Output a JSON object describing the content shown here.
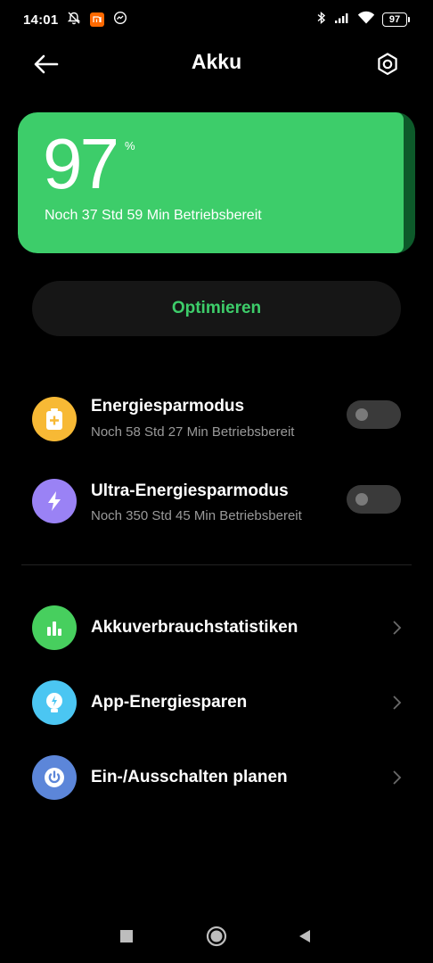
{
  "status_bar": {
    "time": "14:01",
    "battery_level": "97",
    "icons": [
      "alarm-off-icon",
      "mi-app-icon",
      "messenger-icon",
      "bluetooth-icon",
      "signal-icon",
      "wifi-icon",
      "battery-icon"
    ]
  },
  "header": {
    "title": "Akku",
    "back_icon": "arrow-left-icon",
    "settings_icon": "gear-icon"
  },
  "battery": {
    "value": "97",
    "unit": "%",
    "level_percent": 97,
    "remaining": "Noch 37 Std 59 Min Betriebsbereit",
    "color": "#3dcd6a"
  },
  "optimize": {
    "label": "Optimieren",
    "color": "#3dcd6a"
  },
  "modes": [
    {
      "title": "Energiesparmodus",
      "subtitle": "Noch 58 Std 27 Min Betriebsbereit",
      "enabled": false,
      "icon": "battery-plus-icon",
      "icon_color": "#f7b935"
    },
    {
      "title": "Ultra-Energiesparmodus",
      "subtitle": "Noch 350 Std 45 Min Betriebsbereit",
      "enabled": false,
      "icon": "lightning-icon",
      "icon_color": "#9a82f5"
    }
  ],
  "menu": [
    {
      "title": "Akkuverbrauchstatistiken",
      "icon": "bar-chart-icon",
      "icon_color": "#47cf5e"
    },
    {
      "title": "App-Energiesparen",
      "icon": "bulb-bolt-icon",
      "icon_color": "#4bc6f2"
    },
    {
      "title": "Ein-/Ausschalten planen",
      "icon": "power-icon",
      "icon_color": "#5c86d9"
    }
  ],
  "system_nav": [
    "recents-square-icon",
    "home-circle-icon",
    "back-triangle-icon"
  ]
}
